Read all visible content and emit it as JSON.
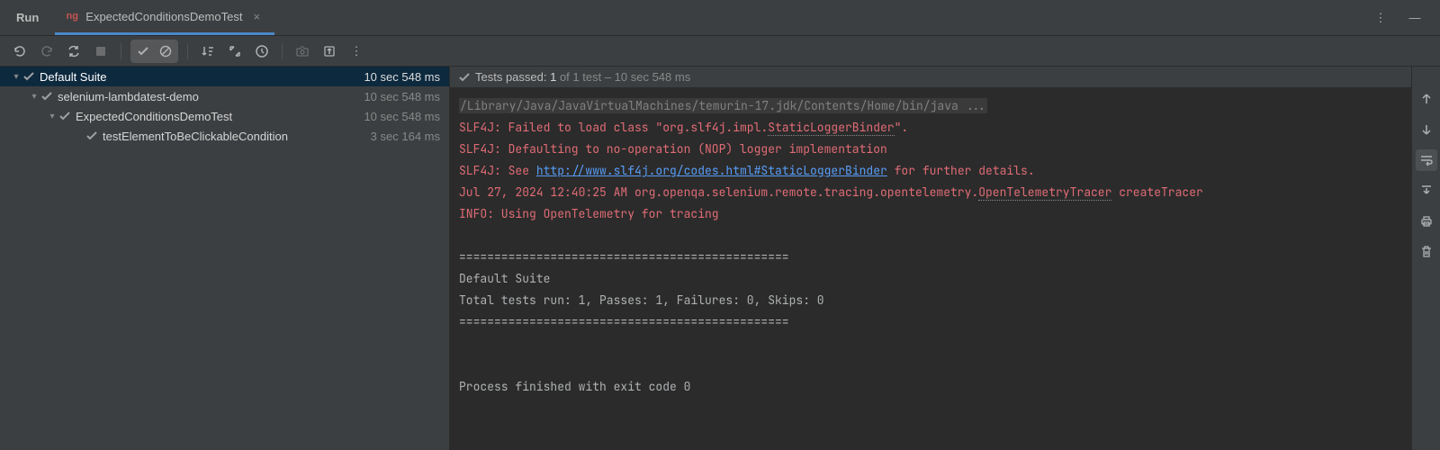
{
  "tabBar": {
    "runLabel": "Run",
    "tabIconText": "ng",
    "tabName": "ExpectedConditionsDemoTest",
    "closeGlyph": "×",
    "moreGlyph": "⋮",
    "minimizeGlyph": "—"
  },
  "toolbar": {
    "rerun": "↻",
    "rerunFailed": "↺",
    "toggleAuto": "⟳",
    "stop": "■",
    "check": "✓",
    "slash": "∅",
    "sortDown": "↧",
    "expandAll": "⤡",
    "clock": "◷",
    "camera": "📷",
    "exit": "⎘",
    "more": "⋮"
  },
  "testTree": {
    "items": [
      {
        "indent": 10,
        "arrow": "▾",
        "label": "Default Suite",
        "time": "10 sec 548 ms",
        "sel": true
      },
      {
        "indent": 30,
        "arrow": "▾",
        "label": "selenium-lambdatest-demo",
        "time": "10 sec 548 ms",
        "sel": false
      },
      {
        "indent": 50,
        "arrow": "▾",
        "label": "ExpectedConditionsDemoTest",
        "time": "10 sec 548 ms",
        "sel": false
      },
      {
        "indent": 80,
        "arrow": "",
        "label": "testElementToBeClickableCondition",
        "time": "3 sec 164 ms",
        "sel": false
      }
    ]
  },
  "consoleHeader": {
    "check": "✓",
    "prefix": "Tests passed: ",
    "passedCount": "1",
    "rest": " of 1 test – 10 sec 548 ms"
  },
  "console": {
    "cmd": "/Library/Java/JavaVirtualMachines/temurin-17.jdk/Contents/Home/bin/java ...",
    "l1a": "SLF4J: Failed to load class \"org.slf4j.impl.",
    "l1b": "StaticLoggerBinder",
    "l1c": "\".",
    "l2": "SLF4J: Defaulting to no-operation (NOP) logger implementation",
    "l3a": "SLF4J: See ",
    "l3link": "http://www.slf4j.org/codes.html#StaticLoggerBinder",
    "l3b": " for further details.",
    "l4a": "Jul 27, 2024 12:40:25 AM org.openqa.selenium.remote.tracing.opentelemetry.",
    "l4b": "OpenTelemetryTracer",
    "l4c": " createTracer",
    "l5": "INFO: Using OpenTelemetry for tracing",
    "sep": "===============================================",
    "suite": "Default Suite",
    "summary": "Total tests run: 1, Passes: 1, Failures: 0, Skips: 0",
    "exit": "Process finished with exit code 0"
  },
  "sideTools": {
    "up": "↑",
    "down": "↓",
    "wrap": "⤆",
    "scroll": "↧",
    "print": "⎙",
    "trash": "🗑"
  }
}
